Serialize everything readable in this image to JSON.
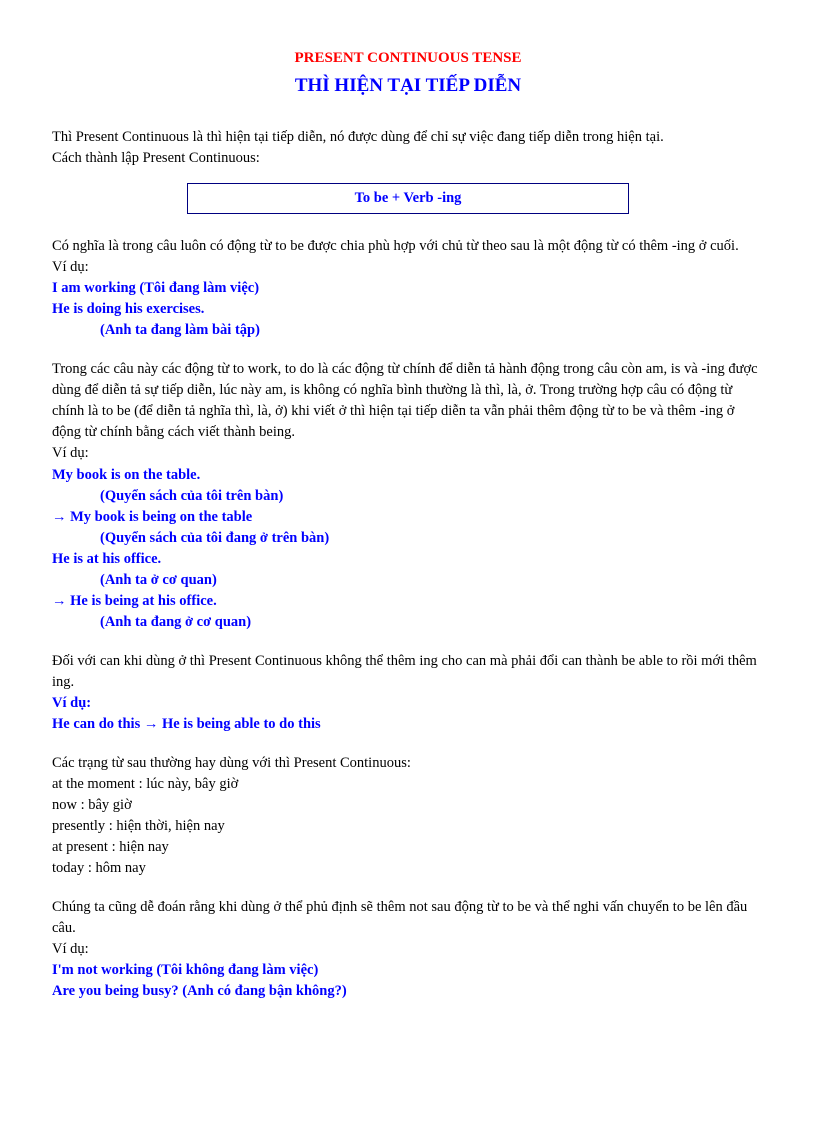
{
  "title": {
    "line1": "PRESENT CONTINUOUS TENSE",
    "line2": "THÌ HIỆN TẠI TIẾP DIỄN"
  },
  "intro": {
    "p1": "Thì Present Continuous là thì hiện tại tiếp diễn, nó được dùng để chỉ sự việc đang tiếp diễn trong hiện tại.",
    "p2": "Cách thành lập Present Continuous:"
  },
  "formula": "To be + Verb -ing",
  "section1": {
    "p1": "Có nghĩa là trong câu luôn có động từ to be được chia phù hợp với chủ từ theo sau là một động từ có thêm -ing ở cuối.",
    "vd": "Ví dụ:",
    "ex1": "I am working (Tôi đang làm việc)",
    "ex2": "He is doing his exercises.",
    "ex2b": "(Anh ta đang làm bài tập)"
  },
  "section2": {
    "p1": "Trong các câu này các động từ to work, to do là các động từ chính để diễn tả hành động trong câu còn am, is và -ing được dùng để diễn tả sự tiếp diễn, lúc này am, is không có nghĩa bình thường là thì, là, ở. Trong trường hợp câu có động từ chính là to be (để diễn tả nghĩa thì, là, ở) khi viết ở thì hiện tại tiếp diễn ta vẫn phải thêm động từ to be và thêm -ing ở động từ chính bằng cách viết thành being.",
    "vd": "Ví dụ:",
    "ex1": "My book is on the table.",
    "ex1b": "(Quyển sách của tôi trên bàn)",
    "ex2": "→ My book is being on the table",
    "ex2b": "(Quyển sách của tôi đang ở trên bàn)",
    "ex3": "He is at his office.",
    "ex3b": "(Anh ta ở cơ quan)",
    "ex4": "→ He is being at his office.",
    "ex4b": "(Anh ta đang ở cơ quan)"
  },
  "section3": {
    "p1": "Đối với can khi dùng ở thì Present Continuous không thể thêm ing cho can mà phải đổi can thành be able to rồi mới thêm ing.",
    "vd": "Ví dụ:",
    "ex1": "He can do this    → He is being able to do this"
  },
  "section4": {
    "p1": "Các trạng từ sau thường hay dùng với thì Present Continuous:",
    "adv1": "at the moment         : lúc này, bây giờ",
    "adv2": "now     : bây giờ",
    "adv3": "presently       : hiện thời, hiện nay",
    "adv4": "at present      : hiện nay",
    "adv5": "today   : hôm nay"
  },
  "section5": {
    "p1": "Chúng ta cũng dễ đoán rằng khi dùng ở thể phủ định sẽ thêm not sau động từ to be và thể nghi vấn chuyển to be lên đầu câu.",
    "vd": "Ví dụ:",
    "ex1": "I'm not working (Tôi không đang làm việc)",
    "ex2": "Are you being busy? (Anh có đang bận không?)"
  }
}
